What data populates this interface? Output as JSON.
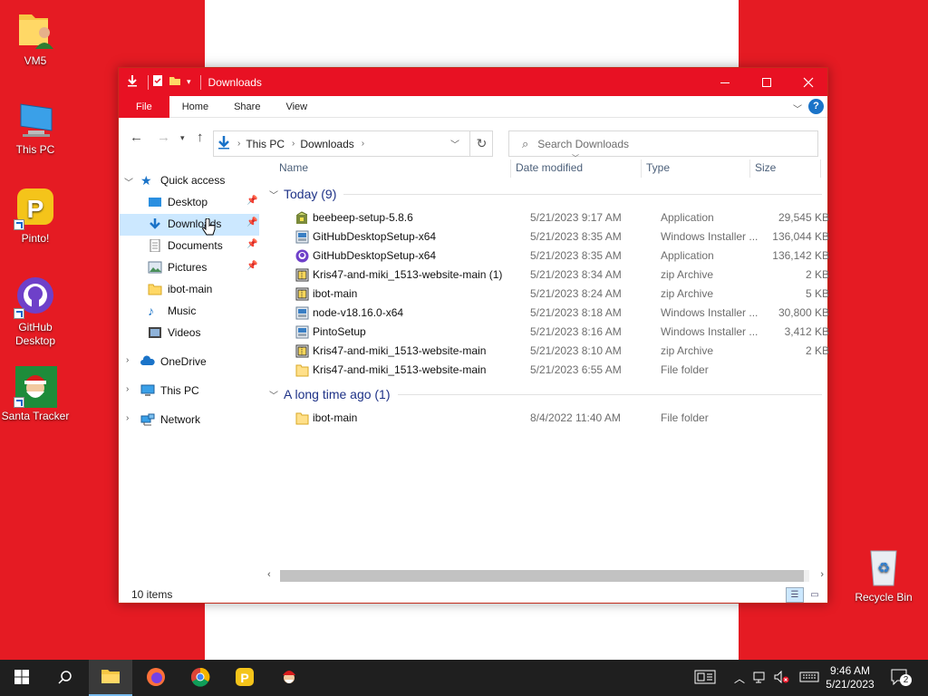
{
  "desktop": {
    "icons": [
      {
        "label": "VM5"
      },
      {
        "label": "This PC"
      },
      {
        "label": "Pinto!"
      },
      {
        "label": "GitHub Desktop"
      },
      {
        "label": "Santa Tracker"
      },
      {
        "label": "Recycle Bin"
      }
    ]
  },
  "window": {
    "title": "Downloads",
    "ribbon": {
      "file": "File",
      "home": "Home",
      "share": "Share",
      "view": "View",
      "help": "?"
    },
    "address": {
      "crumbs": [
        "This PC",
        "Downloads"
      ]
    },
    "search": {
      "placeholder": "Search Downloads"
    }
  },
  "nav": {
    "quick_access": "Quick access",
    "items": [
      "Desktop",
      "Downloads",
      "Documents",
      "Pictures",
      "ibot-main",
      "Music",
      "Videos"
    ],
    "onedrive": "OneDrive",
    "this_pc": "This PC",
    "network": "Network"
  },
  "columns": {
    "name": "Name",
    "date": "Date modified",
    "type": "Type",
    "size": "Size"
  },
  "groups": [
    {
      "label": "Today (9)",
      "files": [
        {
          "name": "beebeep-setup-5.8.6",
          "date": "5/21/2023 9:17 AM",
          "type": "Application",
          "size": "29,545 KB",
          "icon": "installer-icon"
        },
        {
          "name": "GitHubDesktopSetup-x64",
          "date": "5/21/2023 8:35 AM",
          "type": "Windows Installer ...",
          "size": "136,044 KB",
          "icon": "msi-icon"
        },
        {
          "name": "GitHubDesktopSetup-x64",
          "date": "5/21/2023 8:35 AM",
          "type": "Application",
          "size": "136,142 KB",
          "icon": "github-icon"
        },
        {
          "name": "Kris47-and-miki_1513-website-main (1)",
          "date": "5/21/2023 8:34 AM",
          "type": "zip Archive",
          "size": "2 KB",
          "icon": "zip-icon"
        },
        {
          "name": "ibot-main",
          "date": "5/21/2023 8:24 AM",
          "type": "zip Archive",
          "size": "5 KB",
          "icon": "zip-icon"
        },
        {
          "name": "node-v18.16.0-x64",
          "date": "5/21/2023 8:18 AM",
          "type": "Windows Installer ...",
          "size": "30,800 KB",
          "icon": "msi-icon"
        },
        {
          "name": "PintoSetup",
          "date": "5/21/2023 8:16 AM",
          "type": "Windows Installer ...",
          "size": "3,412 KB",
          "icon": "msi-icon"
        },
        {
          "name": "Kris47-and-miki_1513-website-main",
          "date": "5/21/2023 8:10 AM",
          "type": "zip Archive",
          "size": "2 KB",
          "icon": "zip-icon"
        },
        {
          "name": "Kris47-and-miki_1513-website-main",
          "date": "5/21/2023 6:55 AM",
          "type": "File folder",
          "size": "",
          "icon": "folder-icon"
        }
      ]
    },
    {
      "label": "A long time ago (1)",
      "files": [
        {
          "name": "ibot-main",
          "date": "8/4/2022 11:40 AM",
          "type": "File folder",
          "size": "",
          "icon": "folder-icon"
        }
      ]
    }
  ],
  "status": {
    "count": "10 items"
  },
  "taskbar": {
    "time": "9:46 AM",
    "date": "5/21/2023",
    "notifications": "2"
  },
  "colors": {
    "accent": "#e81123",
    "wallpaper_red": "#e51b23",
    "selection": "#cce8ff",
    "group_text": "#1e3287"
  }
}
